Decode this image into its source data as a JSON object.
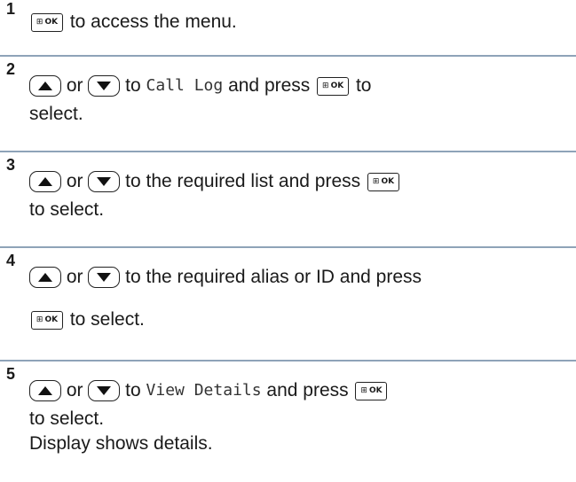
{
  "steps": [
    {
      "number": "1",
      "lines": [
        [
          {
            "icon": "ok-key-icon"
          },
          {
            "text": " to access the menu."
          }
        ]
      ]
    },
    {
      "number": "2",
      "lines": [
        [
          {
            "icon": "up-arrow-key-icon"
          },
          {
            "text": " or "
          },
          {
            "icon": "down-arrow-key-icon"
          },
          {
            "text": " to "
          },
          {
            "mono": "Call Log"
          },
          {
            "text": " and press "
          },
          {
            "icon": "ok-key-icon"
          },
          {
            "text": " to"
          }
        ],
        [
          {
            "text": "select."
          }
        ]
      ]
    },
    {
      "number": "3",
      "lines": [
        [
          {
            "icon": "up-arrow-key-icon"
          },
          {
            "text": " or "
          },
          {
            "icon": "down-arrow-key-icon"
          },
          {
            "text": " to the required list and press "
          },
          {
            "icon": "ok-key-icon"
          }
        ],
        [
          {
            "text": "to select."
          }
        ]
      ]
    },
    {
      "number": "4",
      "lines": [
        [
          {
            "icon": "up-arrow-key-icon"
          },
          {
            "text": " or "
          },
          {
            "icon": "down-arrow-key-icon"
          },
          {
            "text": " to the required alias or ID and press"
          }
        ],
        [
          {
            "icon": "ok-key-icon"
          },
          {
            "text": " to select."
          }
        ]
      ]
    },
    {
      "number": "5",
      "lines": [
        [
          {
            "icon": "up-arrow-key-icon"
          },
          {
            "text": " or "
          },
          {
            "icon": "down-arrow-key-icon"
          },
          {
            "text": " to "
          },
          {
            "mono": "View Details"
          },
          {
            "text": " and press "
          },
          {
            "icon": "ok-key-icon"
          }
        ],
        [
          {
            "text": "to select."
          }
        ],
        [
          {
            "text": "Display shows details."
          }
        ]
      ]
    }
  ],
  "ok_key_label": "OK"
}
